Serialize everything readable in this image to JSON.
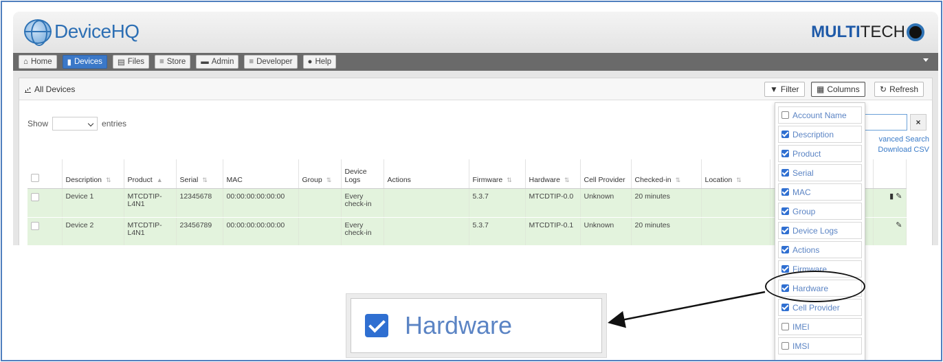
{
  "app": {
    "logo_text": "DeviceHQ",
    "brand_part1": "MULTI",
    "brand_part2": "TECH"
  },
  "nav": {
    "items": [
      {
        "label": "Home",
        "icon": "home-icon"
      },
      {
        "label": "Devices",
        "icon": "signal-icon",
        "active": true
      },
      {
        "label": "Files",
        "icon": "file-icon"
      },
      {
        "label": "Store",
        "icon": "cart-icon"
      },
      {
        "label": "Admin",
        "icon": "briefcase-icon"
      },
      {
        "label": "Developer",
        "icon": "cart-icon"
      },
      {
        "label": "Help",
        "icon": "question-icon"
      }
    ]
  },
  "panel": {
    "title": "All Devices",
    "filter_label": "Filter",
    "columns_label": "Columns",
    "refresh_label": "Refresh"
  },
  "length": {
    "show_label": "Show",
    "entries_label": "entries"
  },
  "search": {
    "clear_label": "×",
    "advanced_label": "vanced Search",
    "csv_label": "Download CSV"
  },
  "table": {
    "headers": [
      "Description",
      "Product",
      "Serial",
      "MAC",
      "Group",
      "Device Logs",
      "Actions",
      "Firmware",
      "Hardware",
      "Cell Provider",
      "Checked-in",
      "Location"
    ],
    "rows": [
      {
        "description": "Device 1",
        "product": "MTCDTIP-L4N1",
        "serial": "12345678",
        "mac": "00:00:00:00:00:00",
        "group": "",
        "logs": "Every check-in",
        "actions": "",
        "firmware": "5.3.7",
        "hardware": "MTCDTIP-0.0",
        "cell": "Unknown",
        "checked": "20 minutes",
        "location": ""
      },
      {
        "description": "Device 2",
        "product": "MTCDTIP-L4N1",
        "serial": "23456789",
        "mac": "00:00:00:00:00:00",
        "group": "",
        "logs": "Every check-in",
        "actions": "",
        "firmware": "5.3.7",
        "hardware": "MTCDTIP-0.1",
        "cell": "Unknown",
        "checked": "20 minutes",
        "location": ""
      }
    ]
  },
  "columns_menu": {
    "items": [
      {
        "label": "Account Name",
        "checked": false
      },
      {
        "label": "Description",
        "checked": true
      },
      {
        "label": "Product",
        "checked": true
      },
      {
        "label": "Serial",
        "checked": true
      },
      {
        "label": "MAC",
        "checked": true
      },
      {
        "label": "Group",
        "checked": true
      },
      {
        "label": "Device Logs",
        "checked": true
      },
      {
        "label": "Actions",
        "checked": true
      },
      {
        "label": "Firmware",
        "checked": true
      },
      {
        "label": "Hardware",
        "checked": true
      },
      {
        "label": "Cell Provider",
        "checked": true
      },
      {
        "label": "IMEI",
        "checked": false
      },
      {
        "label": "IMSI",
        "checked": false
      }
    ]
  },
  "zoom": {
    "label": "Hardware",
    "checked": true
  },
  "colors": {
    "accent": "#2f6fd1",
    "row_bg": "#e3f3dd",
    "nav_active": "#3b78c8",
    "frame": "#4f7fbe"
  }
}
